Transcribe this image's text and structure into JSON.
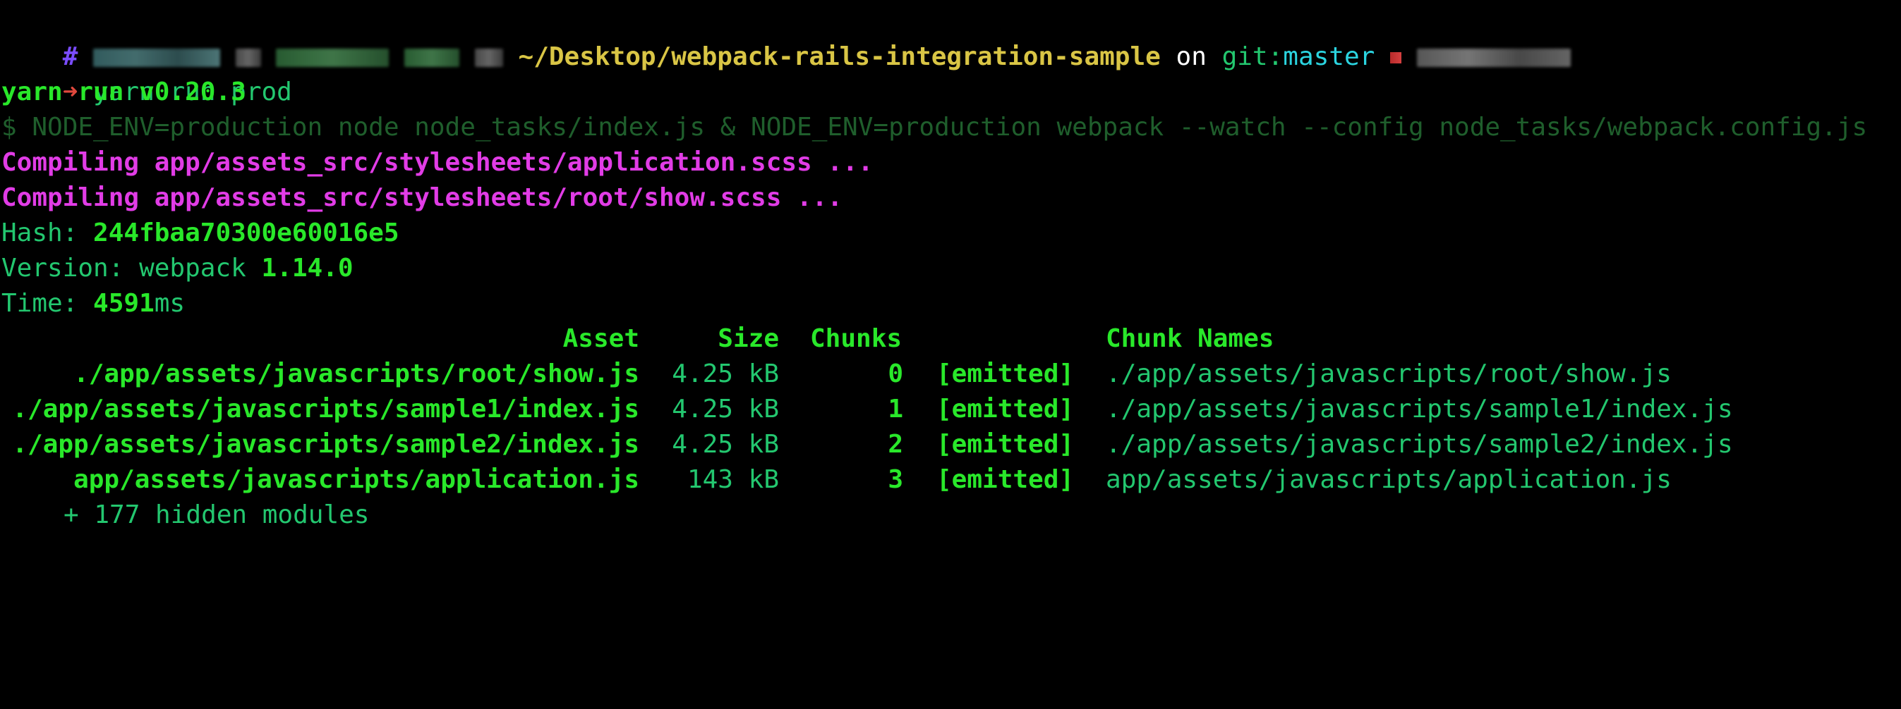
{
  "prompt": {
    "hash_symbol": "#",
    "path": "~/Desktop/webpack-rails-integration-sample",
    "on_word": "on",
    "git_label": "git:",
    "branch": "master",
    "arrow": "➜",
    "command": "yarn run prod"
  },
  "output": {
    "yarn_version_line": "yarn run v0.20.3",
    "exec_line": "$ NODE_ENV=production node node_tasks/index.js & NODE_ENV=production webpack --watch --config node_tasks/webpack.config.js",
    "compiling_1": "Compiling app/assets_src/stylesheets/application.scss ...",
    "compiling_2": "Compiling app/assets_src/stylesheets/root/show.scss ...",
    "hash_label": "Hash: ",
    "hash_value": "244fbaa70300e60016e5",
    "version_label": "Version: webpack ",
    "version_value": "1.14.0",
    "time_label": "Time: ",
    "time_value": "4591",
    "time_unit": "ms"
  },
  "table": {
    "headers": {
      "asset": "Asset",
      "size": "Size",
      "chunks": "Chunks",
      "chunk_names": "Chunk Names"
    },
    "rows": [
      {
        "asset": "./app/assets/javascripts/root/show.js",
        "size": "4.25 kB",
        "chunk": "0",
        "status": "[emitted]",
        "name": "./app/assets/javascripts/root/show.js"
      },
      {
        "asset": "./app/assets/javascripts/sample1/index.js",
        "size": "4.25 kB",
        "chunk": "1",
        "status": "[emitted]",
        "name": "./app/assets/javascripts/sample1/index.js"
      },
      {
        "asset": "./app/assets/javascripts/sample2/index.js",
        "size": "4.25 kB",
        "chunk": "2",
        "status": "[emitted]",
        "name": "./app/assets/javascripts/sample2/index.js"
      },
      {
        "asset": "app/assets/javascripts/application.js",
        "size": "143 kB",
        "chunk": "3",
        "status": "[emitted]",
        "name": "app/assets/javascripts/application.js"
      }
    ],
    "hidden_modules": "+ 177 hidden modules"
  },
  "colors": {
    "background": "#000000",
    "bright_green": "#29e82a",
    "green": "#23c76f",
    "magenta": "#e13ce6",
    "path_yellow": "#d9c545",
    "branch_cyan": "#2bd4e0",
    "arrow_red": "#e0483d",
    "hash_purple": "#7a4cff"
  }
}
